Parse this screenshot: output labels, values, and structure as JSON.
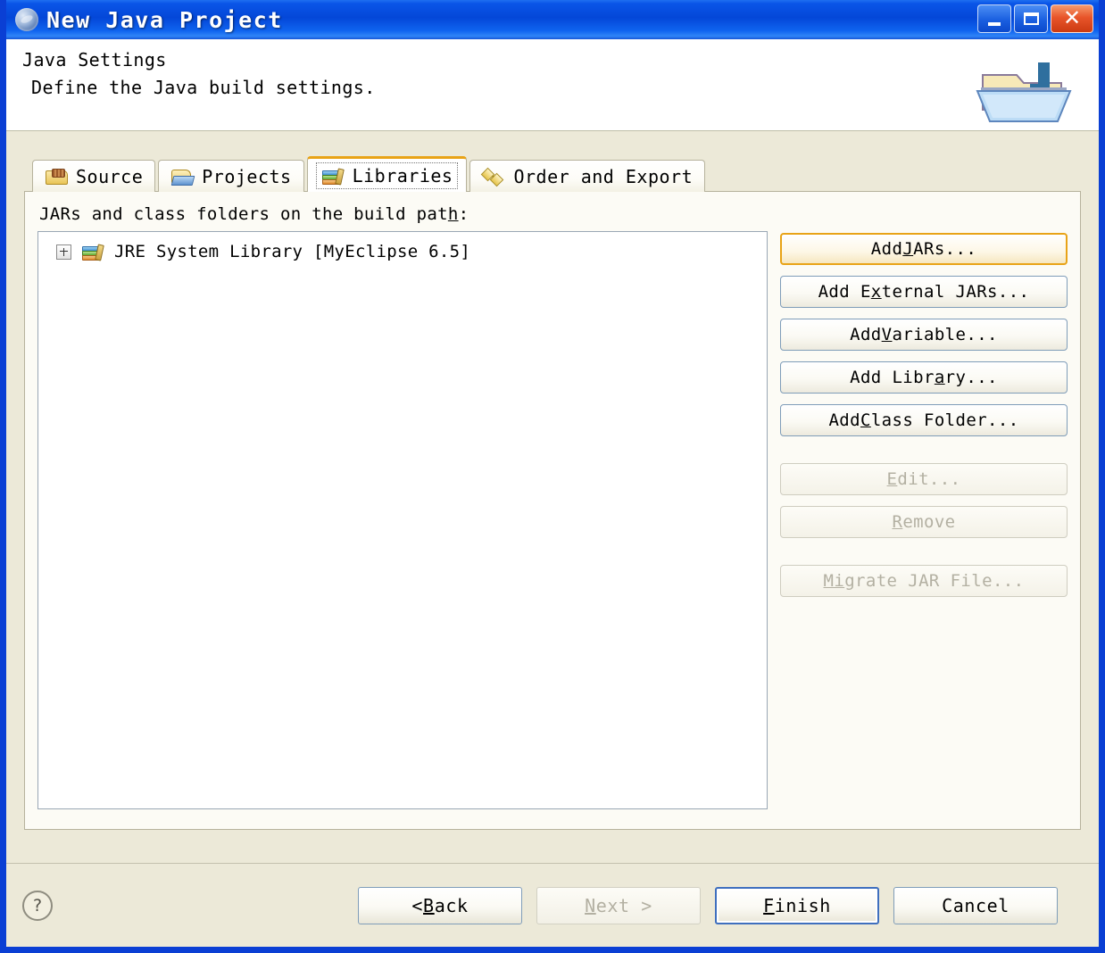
{
  "window": {
    "title": "New Java Project",
    "title_icon": "eclipse-app-icon",
    "minimize_label": "Minimize",
    "maximize_label": "Maximize",
    "close_label": "Close",
    "accent_title_color": "#0a45d8",
    "body_color": "#ece9d8"
  },
  "header": {
    "title": "Java Settings",
    "description": "Define the Java build settings.",
    "icon": "open-folder-java-banner-icon"
  },
  "tabs": [
    {
      "label": "Source",
      "icon": "source-folder-icon",
      "selected": false
    },
    {
      "label": "Projects",
      "icon": "projects-folder-icon",
      "selected": false
    },
    {
      "label": "Libraries",
      "icon": "libraries-books-icon",
      "selected": true
    },
    {
      "label": "Order and Export",
      "icon": "order-export-diamonds-icon",
      "selected": false
    }
  ],
  "libraries_page": {
    "list_label_pre": "JARs and class folders on the build pat",
    "list_label_mnemonic": "h",
    "list_label_post": ":",
    "tree_items": [
      {
        "label": "JRE System Library [MyEclipse 6.5]",
        "icon": "libraries-books-icon",
        "expander": "plus",
        "expanded": false
      }
    ],
    "buttons": [
      {
        "pre": "Add ",
        "mnemonic": "J",
        "post": "ARs...",
        "enabled": true,
        "focused": true,
        "name": "add-jars-button"
      },
      {
        "pre": "Add E",
        "mnemonic": "x",
        "post": "ternal JARs...",
        "enabled": true,
        "focused": false,
        "name": "add-external-jars-button"
      },
      {
        "pre": "Add ",
        "mnemonic": "V",
        "post": "ariable...",
        "enabled": true,
        "focused": false,
        "name": "add-variable-button"
      },
      {
        "pre": "Add Libr",
        "mnemonic": "a",
        "post": "ry...",
        "enabled": true,
        "focused": false,
        "name": "add-library-button"
      },
      {
        "pre": "Add ",
        "mnemonic": "C",
        "post": "lass Folder...",
        "enabled": true,
        "focused": false,
        "name": "add-class-folder-button"
      },
      {
        "pre": "",
        "mnemonic": "E",
        "post": "dit...",
        "enabled": false,
        "focused": false,
        "name": "edit-button"
      },
      {
        "pre": "",
        "mnemonic": "R",
        "post": "emove",
        "enabled": false,
        "focused": false,
        "name": "remove-button"
      },
      {
        "pre": "",
        "mnemonic": "Mi",
        "post": "grate JAR File...",
        "enabled": false,
        "focused": false,
        "name": "migrate-jar-file-button"
      }
    ]
  },
  "footer": {
    "help_icon": "help-question-icon",
    "back_pre": "< ",
    "back_mnemonic": "B",
    "back_post": "ack",
    "next_pre": "",
    "next_mnemonic": "N",
    "next_post": "ext >",
    "finish_pre": "",
    "finish_mnemonic": "F",
    "finish_post": "inish",
    "cancel_label": "Cancel",
    "next_enabled": false,
    "finish_default": true
  }
}
